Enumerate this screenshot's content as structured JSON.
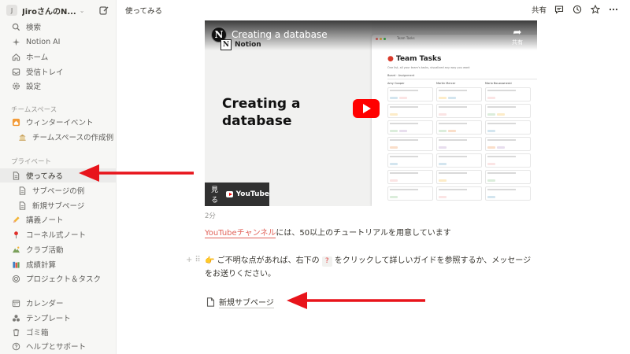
{
  "sidebar": {
    "workspace_name": "JiroさんのN...",
    "workspace_initial": "J",
    "top_items": [
      {
        "label": "検索",
        "icon": "search-icon"
      },
      {
        "label": "Notion AI",
        "icon": "sparkle-icon"
      },
      {
        "label": "ホーム",
        "icon": "home-icon"
      },
      {
        "label": "受信トレイ",
        "icon": "inbox-icon"
      },
      {
        "label": "設定",
        "icon": "gear-icon"
      }
    ],
    "teamspace_label": "チームスペース",
    "teamspace_items": [
      {
        "label": "ウィンターイベント",
        "icon": "house-emoji-icon"
      },
      {
        "label": "チームスペースの作成例",
        "icon": "building-emoji-icon"
      }
    ],
    "private_label": "プライベート",
    "private_items": [
      {
        "label": "使ってみる",
        "icon": "page-icon",
        "active": true
      },
      {
        "label": "サブページの例",
        "icon": "page-icon"
      },
      {
        "label": "新規サブページ",
        "icon": "page-icon"
      },
      {
        "label": "講義ノート",
        "icon": "pencil-emoji-icon"
      },
      {
        "label": "コーネル式ノート",
        "icon": "pin-emoji-icon"
      },
      {
        "label": "クラブ活動",
        "icon": "mountain-emoji-icon"
      },
      {
        "label": "成績計算",
        "icon": "books-emoji-icon"
      },
      {
        "label": "プロジェクト＆タスク",
        "icon": "target-icon"
      }
    ],
    "bottom_items": [
      {
        "label": "カレンダー",
        "icon": "calendar-icon"
      },
      {
        "label": "テンプレート",
        "icon": "shapes-icon"
      },
      {
        "label": "ゴミ箱",
        "icon": "trash-icon"
      },
      {
        "label": "ヘルプとサポート",
        "icon": "help-icon"
      }
    ]
  },
  "topbar": {
    "breadcrumb": "使ってみる",
    "share_label": "共有"
  },
  "video": {
    "title": "Creating a database",
    "channel": "Notion",
    "big_title_line1": "Creating a",
    "big_title_line2": "database",
    "share_label": "共有",
    "watch_label": "見る",
    "youtube_label": "YouTube",
    "mock_title": "Team Tasks",
    "mock_crumb": "Team Tasks",
    "mock_subtitle": "One list, all your team's tasks, visualized any way you want",
    "mock_view": "Board · Assignment",
    "mock_columns": [
      "Amy Cooper",
      "Martin Mercer",
      "Mario Bouzowneski"
    ]
  },
  "content": {
    "duration": "2分",
    "desc_link": "YouTubeチャンネル",
    "desc_rest": "には、50以上のチュートリアルを用意しています",
    "callout_emoji": "👉",
    "callout_pre": "ご不明な点があれば、右下の",
    "callout_key": "?",
    "callout_post": "をクリックして詳しいガイドを参照するか、メッセージをお送りください。",
    "subpage_label": "新規サブページ"
  },
  "colors": {
    "accent_link": "#e16259",
    "annotation_arrow": "#e8141b",
    "youtube_red": "#ff0000",
    "sidebar_bg": "#f7f7f5"
  }
}
